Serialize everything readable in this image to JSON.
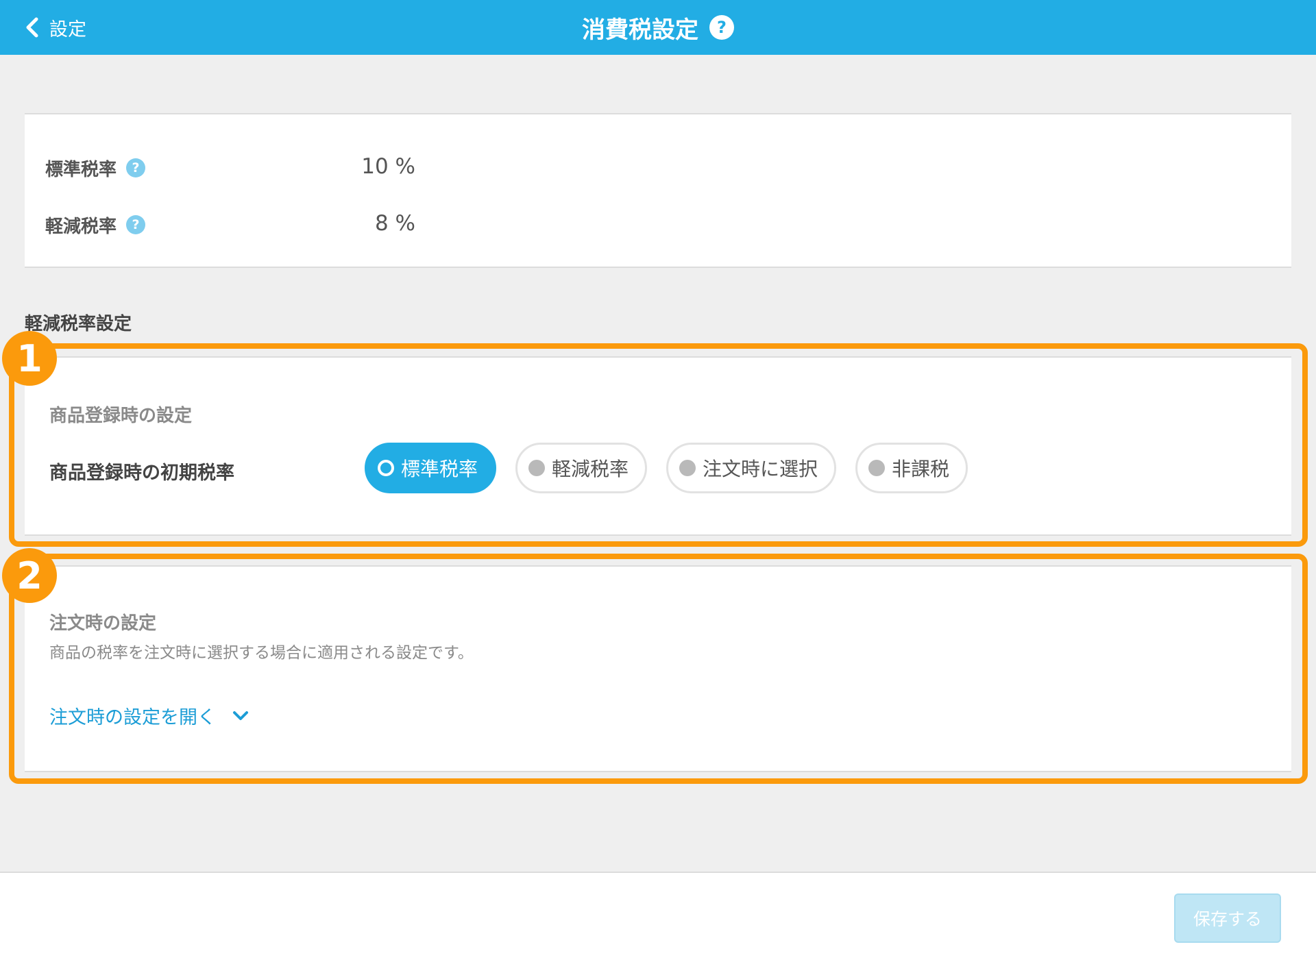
{
  "header": {
    "back_label": "設定",
    "title": "消費税設定",
    "help_symbol": "?"
  },
  "rates": {
    "standard": {
      "label": "標準税率",
      "value": "10 %"
    },
    "reduced": {
      "label": "軽減税率",
      "value": "8 %"
    }
  },
  "reduced_settings": {
    "heading": "軽減税率設定",
    "registration": {
      "subtitle": "商品登録時の設定",
      "field_label": "商品登録時の初期税率",
      "options": [
        "標準税率",
        "軽減税率",
        "注文時に選択",
        "非課税"
      ],
      "selected": "標準税率"
    },
    "order": {
      "subtitle": "注文時の設定",
      "description": "商品の税率を注文時に選択する場合に適用される設定です。",
      "expand_label": "注文時の設定を開く"
    }
  },
  "annotations": {
    "badge_1": "1",
    "badge_2": "2"
  },
  "footer": {
    "save_label": "保存する"
  },
  "colors": {
    "header": "#22ade4",
    "accent": "#22ade4",
    "annotation": "#fb9a0c",
    "link": "#1c9dd6",
    "save_disabled": "#bfe6f5"
  },
  "icons": {
    "back": "chevron-left-icon",
    "help": "question-icon",
    "expand": "chevron-down-icon"
  }
}
